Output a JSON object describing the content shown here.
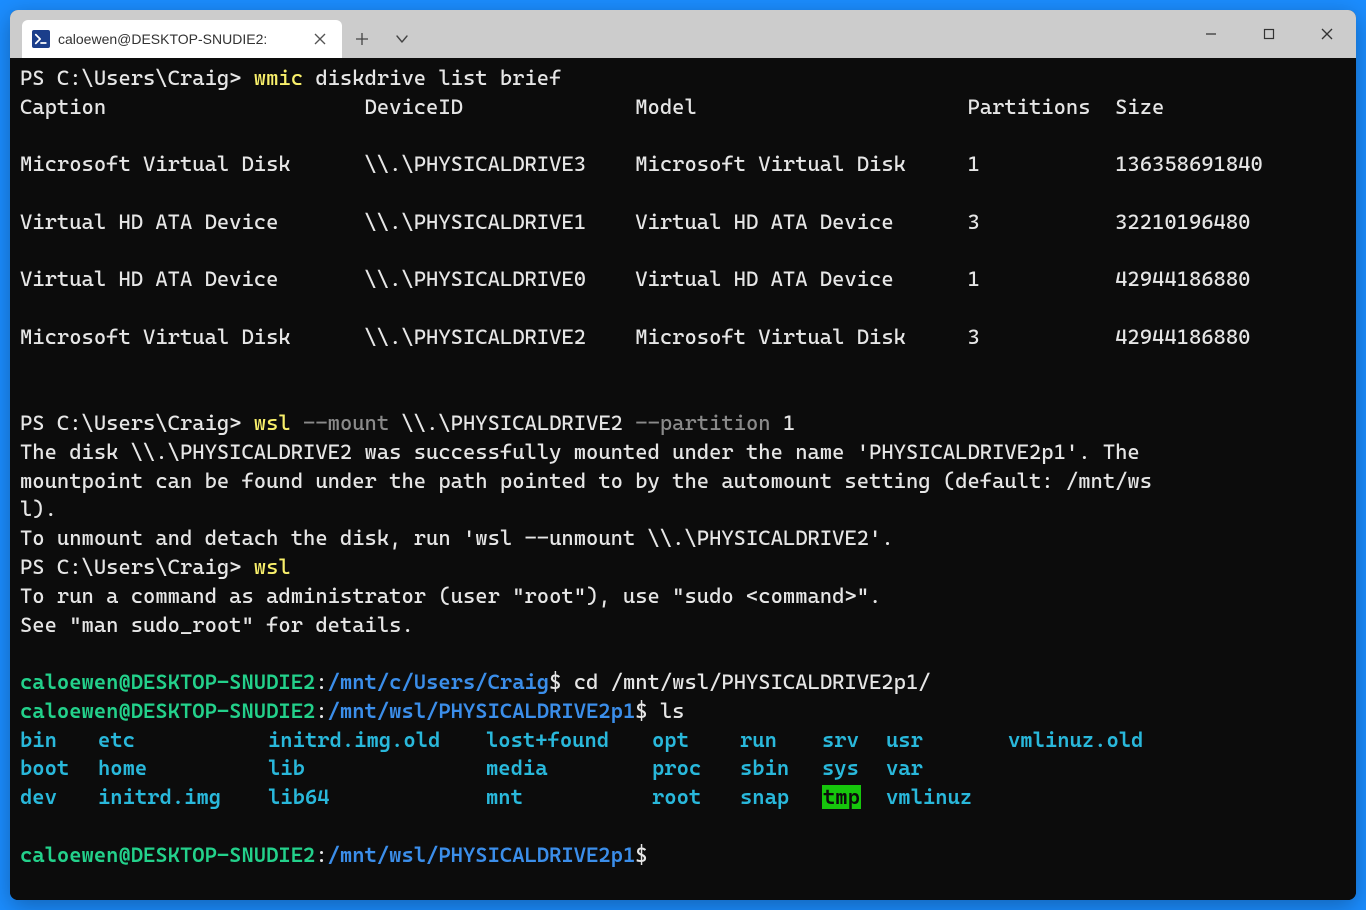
{
  "titlebar": {
    "tab_title": "caloewen@DESKTOP-SNUDIE2:",
    "ps_icon_label": ">_"
  },
  "ps_prompt1": "PS C:\\Users\\Craig> ",
  "cmd1_a": "wmic",
  "cmd1_b": " diskdrive list brief",
  "table": {
    "headers": {
      "c0": "Caption",
      "c1": "DeviceID",
      "c2": "Model",
      "c3": "Partitions",
      "c4": "Size"
    },
    "rows": [
      {
        "c0": "Microsoft Virtual Disk",
        "c1": "\\\\.\\PHYSICALDRIVE3",
        "c2": "Microsoft Virtual Disk",
        "c3": "1",
        "c4": "136358691840"
      },
      {
        "c0": "Virtual HD ATA Device",
        "c1": "\\\\.\\PHYSICALDRIVE1",
        "c2": "Virtual HD ATA Device",
        "c3": "3",
        "c4": "32210196480"
      },
      {
        "c0": "Virtual HD ATA Device",
        "c1": "\\\\.\\PHYSICALDRIVE0",
        "c2": "Virtual HD ATA Device",
        "c3": "1",
        "c4": "42944186880"
      },
      {
        "c0": "Microsoft Virtual Disk",
        "c1": "\\\\.\\PHYSICALDRIVE2",
        "c2": "Microsoft Virtual Disk",
        "c3": "3",
        "c4": "42944186880"
      }
    ]
  },
  "cmd2": {
    "a": "wsl",
    "b": " --mount",
    "c": " \\\\.\\PHYSICALDRIVE2",
    "d": " --partition",
    "e": " 1"
  },
  "mount_msg": "The disk \\\\.\\PHYSICALDRIVE2 was successfully mounted under the name 'PHYSICALDRIVE2p1'. The\nmountpoint can be found under the path pointed to by the automount setting (default: /mnt/ws\nl).\nTo unmount and detach the disk, run 'wsl --unmount \\\\.\\PHYSICALDRIVE2'.",
  "cmd3": "wsl",
  "sudo_msg": "To run a command as administrator (user \"root\"), use \"sudo <command>\".\nSee \"man sudo_root\" for details.",
  "bash1": {
    "userhost": "caloewen@DESKTOP-SNUDIE2",
    "colon": ":",
    "path": "/mnt/c/Users/Craig",
    "dollar": "$",
    "cmd": " cd /mnt/wsl/PHYSICALDRIVE2p1/"
  },
  "bash2": {
    "userhost": "caloewen@DESKTOP-SNUDIE2",
    "colon": ":",
    "path": "/mnt/wsl/PHYSICALDRIVE2p1",
    "dollar": "$",
    "cmd": " ls"
  },
  "ls": {
    "row1": [
      "bin",
      "etc",
      "initrd.img.old",
      "lost+found",
      "opt",
      "run",
      "srv",
      "usr",
      "vmlinuz.old"
    ],
    "row2": [
      "boot",
      "home",
      "lib",
      "media",
      "proc",
      "sbin",
      "sys",
      "var",
      ""
    ],
    "row3": [
      "dev",
      "initrd.img",
      "lib64",
      "mnt",
      "root",
      "snap",
      "tmp",
      "vmlinuz",
      ""
    ]
  },
  "bash3": {
    "userhost": "caloewen@DESKTOP-SNUDIE2",
    "colon": ":",
    "path": "/mnt/wsl/PHYSICALDRIVE2p1",
    "dollar": "$"
  }
}
